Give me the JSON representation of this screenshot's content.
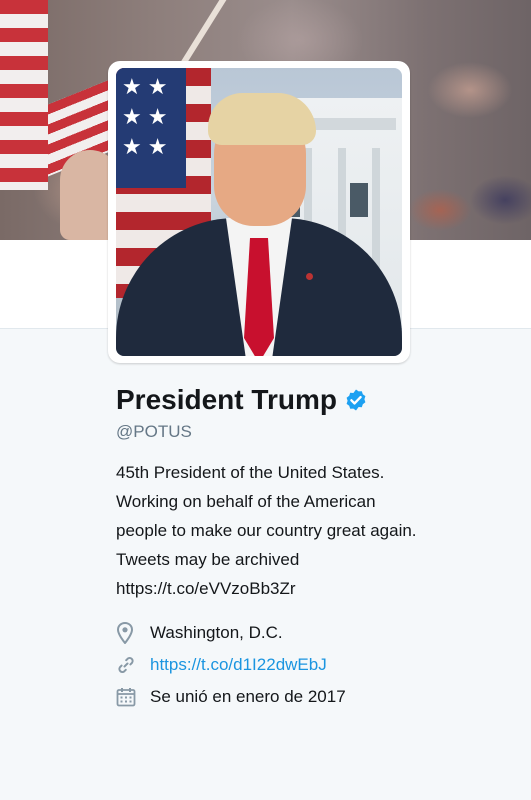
{
  "profile": {
    "name": "President Trump",
    "handle": "@POTUS",
    "verified": true,
    "bio_lines": [
      "45th President of the United States.",
      "Working on behalf of the American",
      "people to make our country great again.",
      "Tweets may be archived",
      "https://t.co/eVVzoBb3Zr"
    ],
    "location": "Washington, D.C.",
    "website": "https://t.co/d1I22dwEbJ",
    "joined": "Se unió en enero de 2017"
  },
  "icons": {
    "verified": "verified-badge-icon",
    "location": "map-pin-icon",
    "website": "link-icon",
    "joined": "calendar-icon"
  },
  "colors": {
    "link": "#1b95e0",
    "verified": "#1da1f2",
    "secondary_text": "#657786",
    "meta_icon": "#8899a6",
    "background": "#f5f8fa"
  }
}
